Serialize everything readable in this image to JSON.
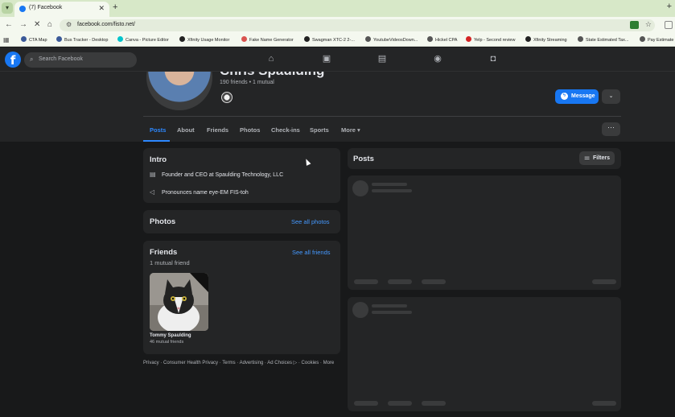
{
  "browser": {
    "tab_title": "(7) Facebook",
    "url": "facebook.com/fisto.net/",
    "bookmarks": [
      {
        "label": "CTA Map",
        "color": "#3b5998"
      },
      {
        "label": "Bus Tracker - Desktop",
        "color": "#3b5998"
      },
      {
        "label": "Canva - Picture Editor",
        "color": "#00c4cc"
      },
      {
        "label": "Xfinity Usage Monitor",
        "color": "#222222"
      },
      {
        "label": "Fake Name Generator",
        "color": "#d9534f"
      },
      {
        "label": "Swagman XTC-2 2-...",
        "color": "#222222"
      },
      {
        "label": "YoutubeVideosDown...",
        "color": "#555555"
      },
      {
        "label": "Hickel CPA",
        "color": "#555555"
      },
      {
        "label": "Yelp - Second review",
        "color": "#d32323"
      },
      {
        "label": "Xfinity Streaming",
        "color": "#222222"
      },
      {
        "label": "State Estimated Tax...",
        "color": "#555555"
      },
      {
        "label": "Pay Estimate",
        "color": "#555555"
      }
    ]
  },
  "fb": {
    "search_placeholder": "Search Facebook"
  },
  "profile": {
    "name": "Chris Spaulding",
    "friends_summary": "190 friends • 1 mutual",
    "message_label": "Message",
    "tabs": [
      "Posts",
      "About",
      "Friends",
      "Photos",
      "Check-ins",
      "Sports",
      "More"
    ]
  },
  "intro": {
    "title": "Intro",
    "work": "Founder and CEO at Spaulding Technology, LLC",
    "pronounce": "Pronounces name eye-EM FIS-toh"
  },
  "photos": {
    "title": "Photos",
    "see_all": "See all photos"
  },
  "friends": {
    "title": "Friends",
    "see_all": "See all friends",
    "mutual": "1 mutual friend",
    "items": [
      {
        "name": "Tommy Spaulding",
        "sub": "46 mutual friends"
      }
    ]
  },
  "footer": "Privacy · Consumer Health Privacy · Terms · Advertising · Ad Choices ▷ · Cookies · More",
  "posts": {
    "title": "Posts",
    "filters_label": "Filters"
  },
  "colors": {
    "accent": "#1877f2",
    "link": "#4599ff",
    "background": "#18191a",
    "card": "#242526"
  }
}
